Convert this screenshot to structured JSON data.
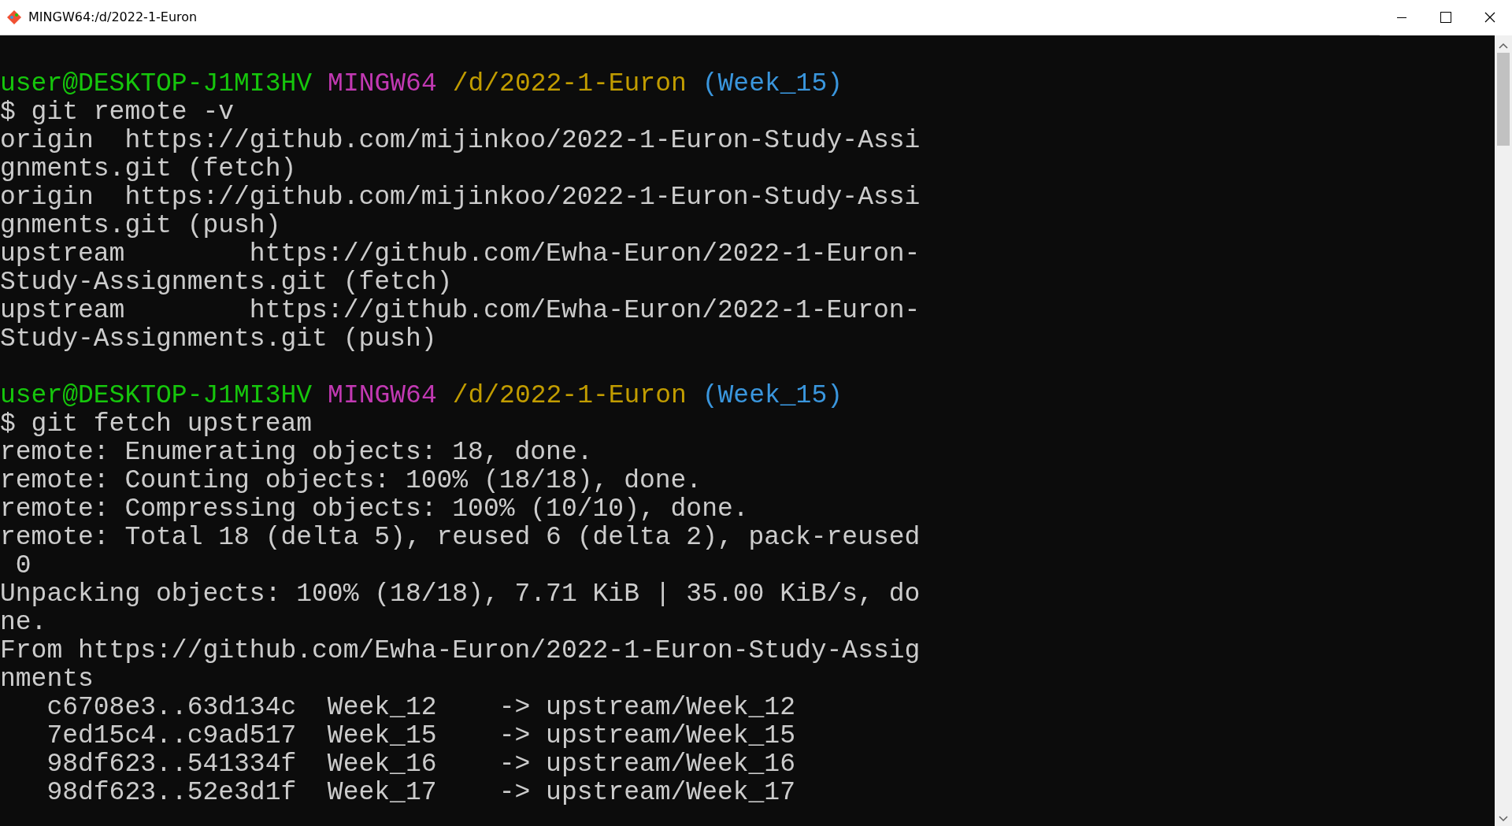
{
  "window": {
    "title": "MINGW64:/d/2022-1-Euron"
  },
  "lines": [
    {
      "kind": "blank"
    },
    {
      "kind": "prompt",
      "user": "user@DESKTOP-J1MI3HV",
      "shell": "MINGW64",
      "path": "/d/2022-1-Euron",
      "branch": "(Week_15)"
    },
    {
      "kind": "text",
      "text": "$ git remote -v"
    },
    {
      "kind": "text",
      "text": "origin  https://github.com/mijinkoo/2022-1-Euron-Study-Assi"
    },
    {
      "kind": "text",
      "text": "gnments.git (fetch)"
    },
    {
      "kind": "text",
      "text": "origin  https://github.com/mijinkoo/2022-1-Euron-Study-Assi"
    },
    {
      "kind": "text",
      "text": "gnments.git (push)"
    },
    {
      "kind": "text",
      "text": "upstream        https://github.com/Ewha-Euron/2022-1-Euron-"
    },
    {
      "kind": "text",
      "text": "Study-Assignments.git (fetch)"
    },
    {
      "kind": "text",
      "text": "upstream        https://github.com/Ewha-Euron/2022-1-Euron-"
    },
    {
      "kind": "text",
      "text": "Study-Assignments.git (push)"
    },
    {
      "kind": "blank"
    },
    {
      "kind": "prompt",
      "user": "user@DESKTOP-J1MI3HV",
      "shell": "MINGW64",
      "path": "/d/2022-1-Euron",
      "branch": "(Week_15)"
    },
    {
      "kind": "text",
      "text": "$ git fetch upstream"
    },
    {
      "kind": "text",
      "text": "remote: Enumerating objects: 18, done."
    },
    {
      "kind": "text",
      "text": "remote: Counting objects: 100% (18/18), done."
    },
    {
      "kind": "text",
      "text": "remote: Compressing objects: 100% (10/10), done."
    },
    {
      "kind": "text",
      "text": "remote: Total 18 (delta 5), reused 6 (delta 2), pack-reused"
    },
    {
      "kind": "text",
      "text": " 0"
    },
    {
      "kind": "text",
      "text": "Unpacking objects: 100% (18/18), 7.71 KiB | 35.00 KiB/s, do"
    },
    {
      "kind": "text",
      "text": "ne."
    },
    {
      "kind": "text",
      "text": "From https://github.com/Ewha-Euron/2022-1-Euron-Study-Assig"
    },
    {
      "kind": "text",
      "text": "nments"
    },
    {
      "kind": "text",
      "text": "   c6708e3..63d134c  Week_12    -> upstream/Week_12"
    },
    {
      "kind": "text",
      "text": "   7ed15c4..c9ad517  Week_15    -> upstream/Week_15"
    },
    {
      "kind": "text",
      "text": "   98df623..541334f  Week_16    -> upstream/Week_16"
    },
    {
      "kind": "text",
      "text": "   98df623..52e3d1f  Week_17    -> upstream/Week_17"
    }
  ]
}
